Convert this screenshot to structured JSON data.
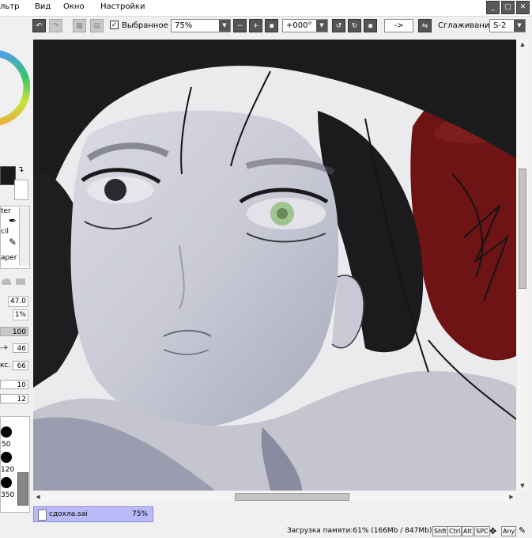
{
  "menu": {
    "items": [
      "льтр",
      "Вид",
      "Окно",
      "Настройки"
    ]
  },
  "window_buttons": {
    "minimize": "_",
    "maximize": "▢",
    "close": "✕"
  },
  "toolbar": {
    "selection_label": "Выбранное",
    "selection_checked": true,
    "zoom": "75%",
    "rotation": "+000°",
    "flip": "->",
    "stabilizer_label": "Сглаживание",
    "stabilizer_value": "S-2"
  },
  "left_panel": {
    "tool_labels": [
      "ter",
      "cil",
      "aper"
    ],
    "values": {
      "size": "47.0",
      "min_size": "1%",
      "density": "100",
      "blend": "46",
      "dilution": "66",
      "persistence": "10",
      "extra": "12"
    },
    "blend_prefix": "-+",
    "dilution_prefix": "кс.",
    "brush_sizes": [
      "50",
      "120",
      "350"
    ]
  },
  "file_tab": {
    "name": "сдохла.sai",
    "zoom": "75%"
  },
  "status": {
    "memory": "Загрузка памяти:61% (166Mb / 847Mb)",
    "modifier_keys": [
      "Shft",
      "Ctrl",
      "Alt",
      "SPC",
      "Any"
    ]
  },
  "colors": {
    "accent_tab": "#b9baf7",
    "hair": "#1b1b1d",
    "background_red": "#6e1414",
    "eye_green": "#9fc48f"
  }
}
